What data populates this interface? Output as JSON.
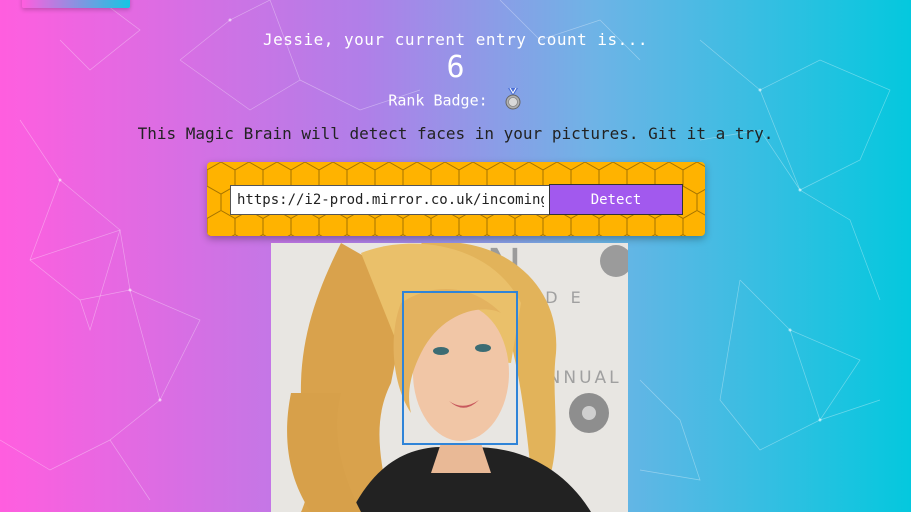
{
  "header": {
    "greeting": "Jessie, your current entry count is...",
    "entry_count": "6",
    "rank_label": "Rank Badge:"
  },
  "tagline": "This Magic Brain will detect faces in your pictures. Git it a try.",
  "form": {
    "url_value": "https://i2-prod.mirror.co.uk/incoming",
    "detect_label": "Detect"
  },
  "colors": {
    "background_left": "#ff5edf",
    "background_right": "#04c8de",
    "panel": "#ffb300",
    "button": "#a259ee",
    "face_box": "#2f84d8"
  },
  "icons": {
    "rank_badge": "medal-icon"
  }
}
